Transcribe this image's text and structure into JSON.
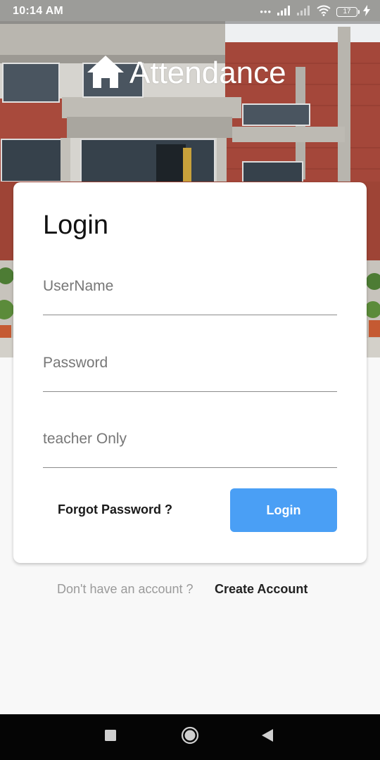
{
  "status_bar": {
    "time": "10:14 AM",
    "dots": "•••",
    "battery_level": "17"
  },
  "app": {
    "title": "Attendance",
    "icon": "home-icon"
  },
  "login_card": {
    "title": "Login",
    "username_placeholder": "UserName",
    "password_placeholder": "Password",
    "teacher_placeholder": "teacher Only",
    "forgot_password_label": "Forgot Password ?",
    "login_button_label": "Login"
  },
  "signup": {
    "prompt": "Don't have an account ?",
    "create_account_label": "Create Account"
  },
  "nav_bar": {
    "icons": [
      "recents-icon",
      "home-circle-icon",
      "back-icon"
    ]
  },
  "colors": {
    "accent": "#4a9ff5",
    "background": "#f8f8f8",
    "card": "#ffffff",
    "nav_bar": "#050505"
  }
}
